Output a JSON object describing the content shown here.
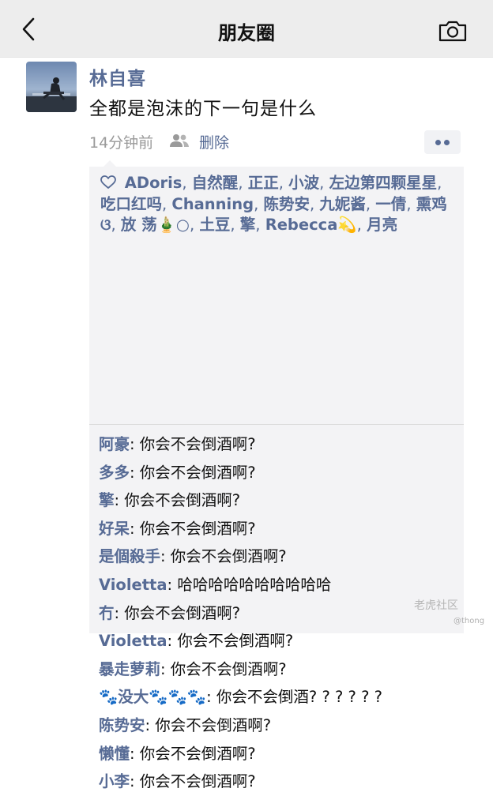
{
  "header": {
    "title": "朋友圈",
    "back_icon": "chevron-left-icon",
    "camera_icon": "camera-icon",
    "background": "#ededed"
  },
  "post": {
    "author": "林自喜",
    "text": "全都是泡沫的下一句是什么",
    "time": "14分钟前",
    "visibility_icon": "friends-icon",
    "delete_label": "删除",
    "more_icon": "more-dots-icon"
  },
  "likes": {
    "icon": "heart-outline-icon",
    "names": [
      "ADoris",
      "自然醒",
      "正正",
      "小波",
      "左边第四颗星星",
      "吃口红吗",
      "Channing",
      "陈势安",
      "九妮酱",
      "一倩",
      "熏鸡ଓ",
      "放 荡🎍○",
      "土豆",
      "擎",
      "Rebecca💫",
      "月亮"
    ]
  },
  "comments": [
    {
      "name": "阿豪",
      "text": ": 你会不会倒酒啊?"
    },
    {
      "name": "多多",
      "text": ": 你会不会倒酒啊?"
    },
    {
      "name": "擎",
      "text": ": 你会不会倒酒啊?"
    },
    {
      "name": "好呆",
      "text": ": 你会不会倒酒啊?"
    },
    {
      "name": "是個殺手",
      "text": ": 你会不会倒酒啊?"
    },
    {
      "name": "Violetta",
      "text": ": 哈哈哈哈哈哈哈哈哈哈"
    },
    {
      "name": "冇",
      "text": ": 你会不会倒酒啊?"
    },
    {
      "name": "Violetta",
      "text": ": 你会不会倒酒啊?"
    },
    {
      "name": "暴走萝莉",
      "text": ": 你会不会倒酒啊?"
    },
    {
      "name": "🐾没大🐾🐾🐾",
      "text": ": 你会不会倒酒? ? ? ? ? ?"
    },
    {
      "name": "陈势安",
      "text": ": 你会不会倒酒啊?"
    },
    {
      "name": "懒懂",
      "text": ": 你会不会倒酒啊?"
    },
    {
      "name": "小李",
      "text": ": 你会不会倒酒啊?"
    }
  ],
  "watermark": {
    "brand": "老虎社区",
    "handle": "@thong"
  },
  "colors": {
    "link": "#576b95",
    "panel": "#f3f3f5",
    "meta": "#9a9a9a"
  }
}
